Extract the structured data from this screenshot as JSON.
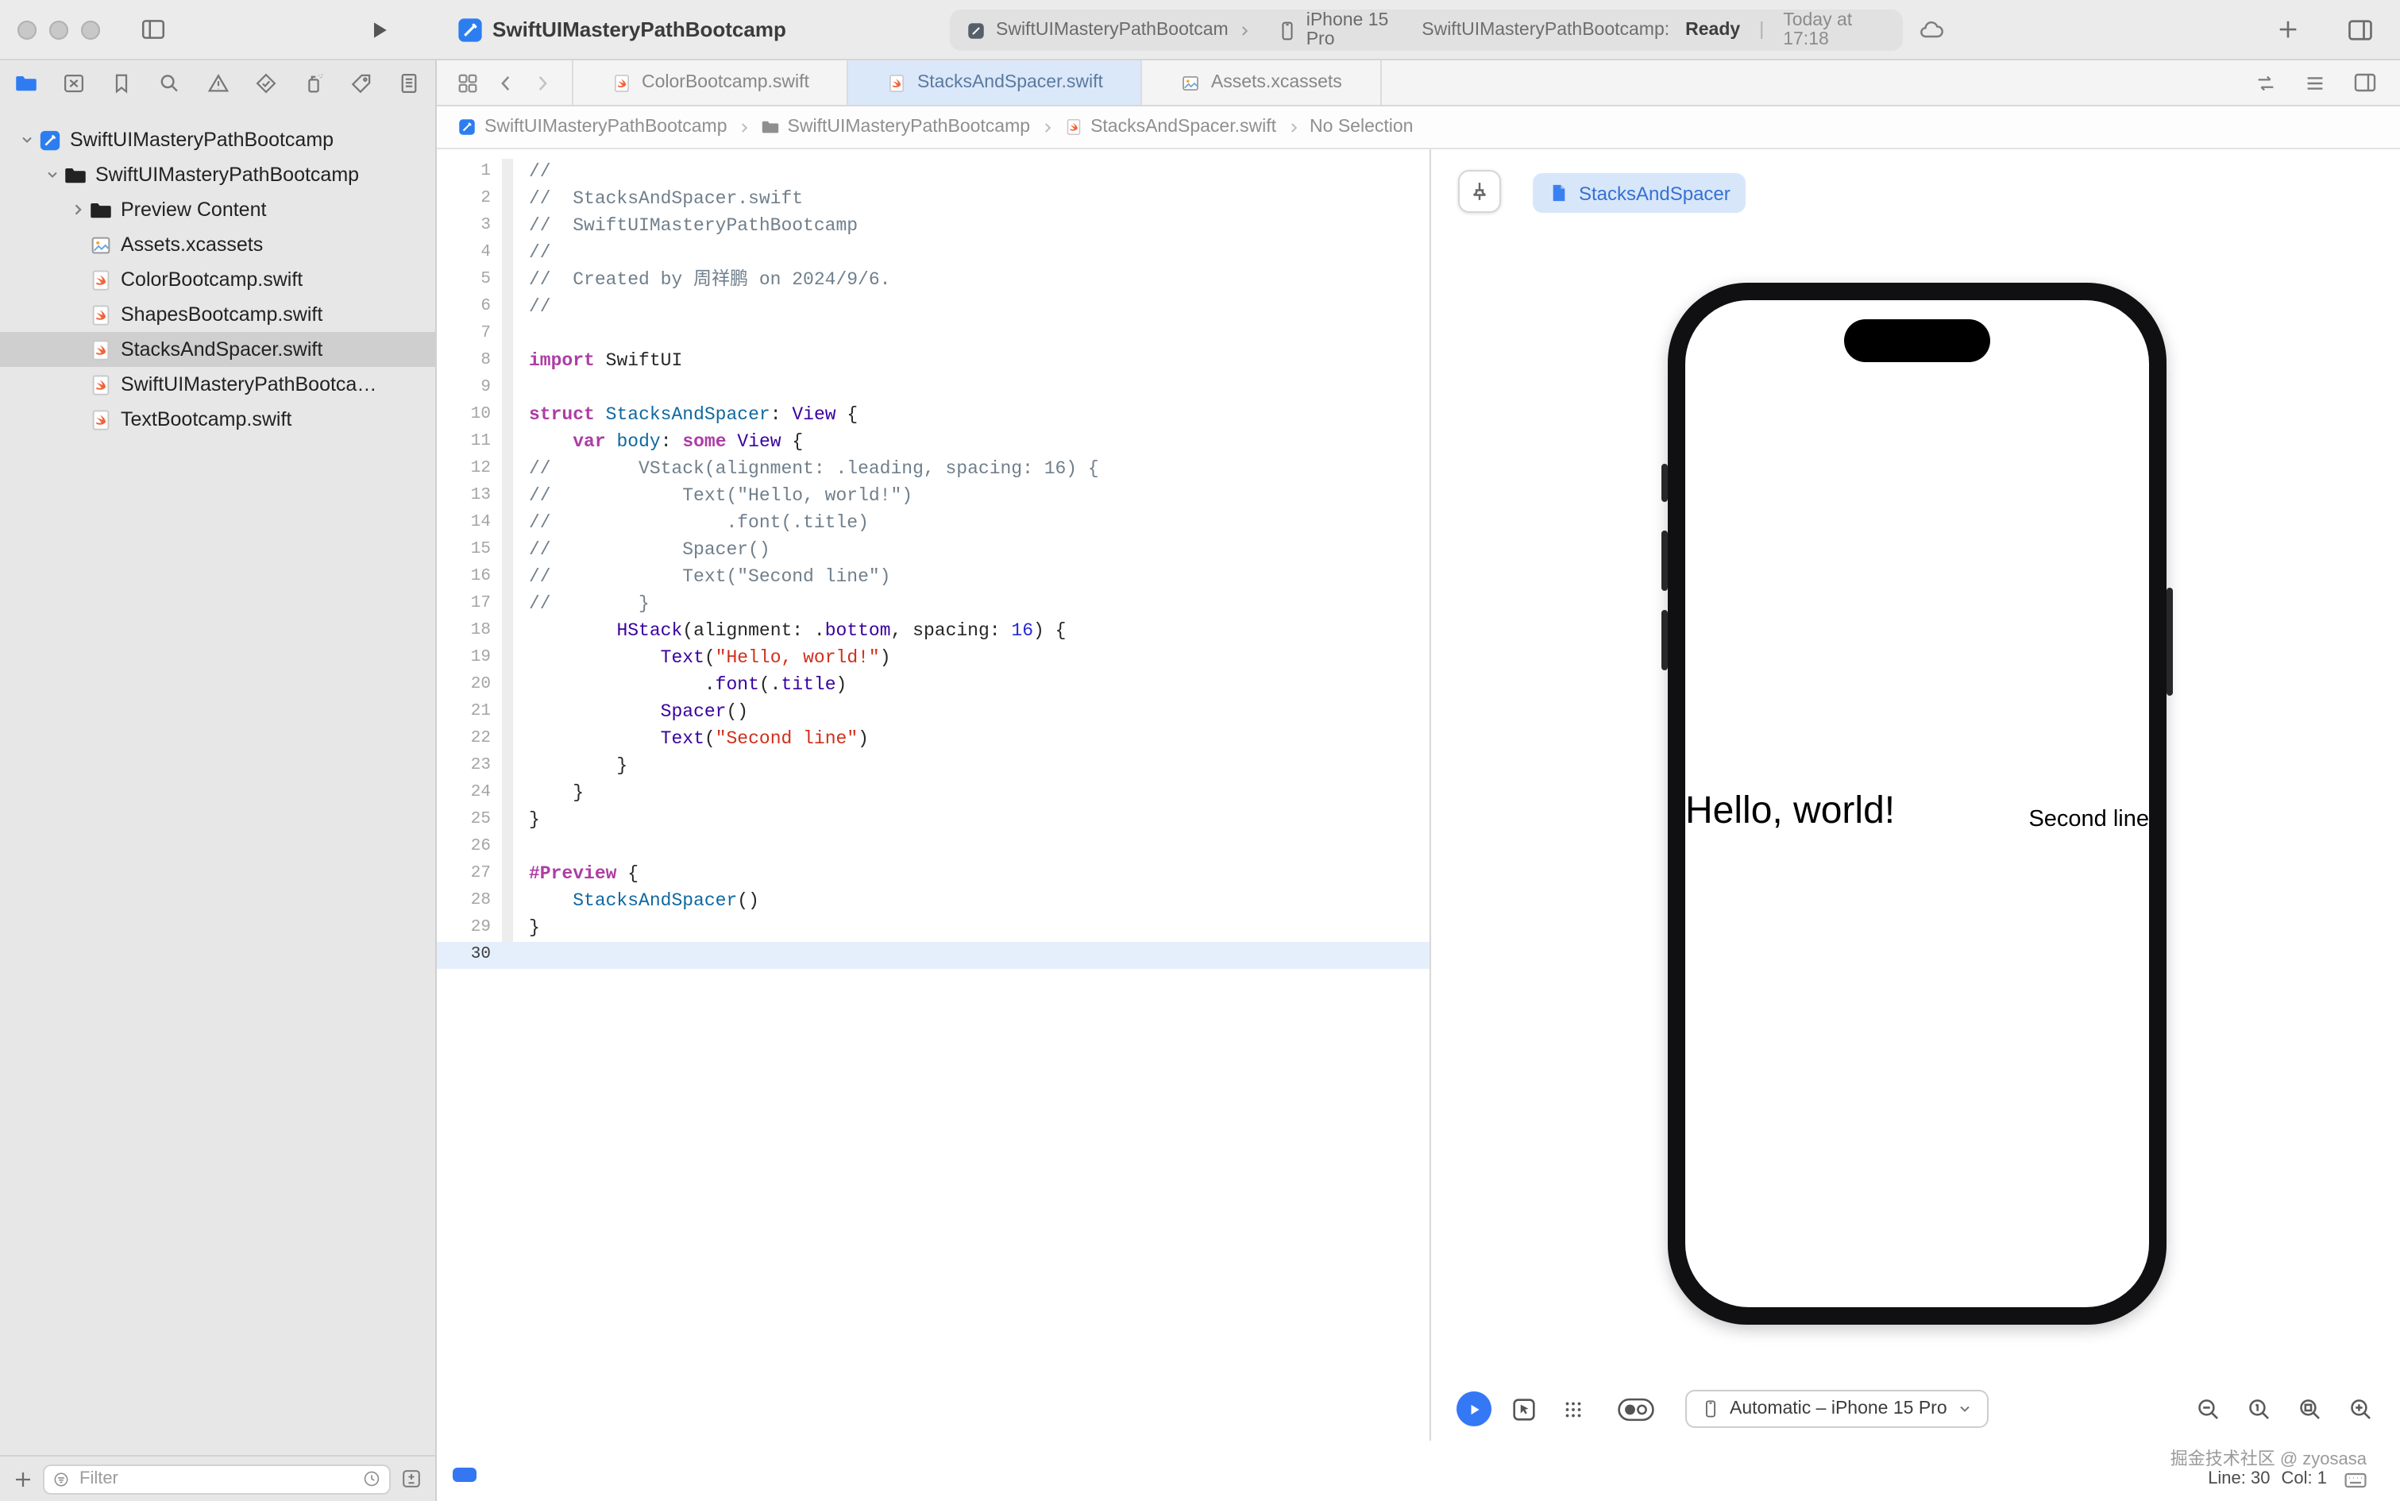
{
  "colors": {
    "accent": "#3478f6",
    "tab_active_bg": "#dbe8fa",
    "chip_bg": "#d8e6fa",
    "selection_bg": "#cfcfcf",
    "current_line_bg": "#e5effc",
    "syntax": {
      "comment": "#707f8c",
      "keyword": "#ad3da4",
      "plain": "#262626",
      "type": "#3900a0",
      "declaration": "#0f68a0",
      "string": "#d12f1b",
      "number": "#272ad8"
    }
  },
  "titlebar": {
    "title": "SwiftUIMasteryPathBootcamp",
    "scheme": "SwiftUIMasteryPathBootcam",
    "destination": "iPhone 15 Pro",
    "status_project": "SwiftUIMasteryPathBootcamp:",
    "status_state": "Ready",
    "status_separator": "|",
    "status_time": "Today at 17:18"
  },
  "tabbar": {
    "tabs": [
      {
        "label": "ColorBootcamp.swift",
        "icon": "swiftdoc",
        "active": false
      },
      {
        "label": "StacksAndSpacer.swift",
        "icon": "swiftdoc",
        "active": true
      },
      {
        "label": "Assets.xcassets",
        "icon": "assets",
        "active": false
      }
    ]
  },
  "jumpbar": {
    "items": [
      {
        "label": "SwiftUIMasteryPathBootcamp",
        "icon": "appicon"
      },
      {
        "label": "SwiftUIMasteryPathBootcamp",
        "icon": "folder"
      },
      {
        "label": "StacksAndSpacer.swift",
        "icon": "swiftdoc"
      },
      {
        "label": "No Selection",
        "icon": null
      }
    ]
  },
  "sidebar": {
    "tree": [
      {
        "label": "SwiftUIMasteryPathBootcamp",
        "icon": "appicon",
        "depth": 0,
        "chevron": "down",
        "selected": false
      },
      {
        "label": "SwiftUIMasteryPathBootcamp",
        "icon": "folder",
        "depth": 1,
        "chevron": "down",
        "selected": false
      },
      {
        "label": "Preview Content",
        "icon": "folder",
        "depth": 2,
        "chevron": "right",
        "selected": false
      },
      {
        "label": "Assets.xcassets",
        "icon": "assets",
        "depth": 2,
        "chevron": null,
        "selected": false
      },
      {
        "label": "ColorBootcamp.swift",
        "icon": "swiftdoc",
        "depth": 2,
        "chevron": null,
        "selected": false
      },
      {
        "label": "ShapesBootcamp.swift",
        "icon": "swiftdoc",
        "depth": 2,
        "chevron": null,
        "selected": false
      },
      {
        "label": "StacksAndSpacer.swift",
        "icon": "swiftdoc",
        "depth": 2,
        "chevron": null,
        "selected": true
      },
      {
        "label": "SwiftUIMasteryPathBootca…",
        "icon": "swiftdoc",
        "depth": 2,
        "chevron": null,
        "selected": false
      },
      {
        "label": "TextBootcamp.swift",
        "icon": "swiftdoc",
        "depth": 2,
        "chevron": null,
        "selected": false
      }
    ],
    "filter_placeholder": "Filter"
  },
  "editor": {
    "current_line": 30,
    "line_count": 30,
    "lines": [
      [
        [
          "//",
          "c"
        ]
      ],
      [
        [
          "//  StacksAndSpacer.swift",
          "c"
        ]
      ],
      [
        [
          "//  SwiftUIMasteryPathBootcamp",
          "c"
        ]
      ],
      [
        [
          "//",
          "c"
        ]
      ],
      [
        [
          "//  Created by 周祥鹏 on 2024/9/6.",
          "c"
        ]
      ],
      [
        [
          "//",
          "c"
        ]
      ],
      [],
      [
        [
          "import",
          "k"
        ],
        [
          " SwiftUI",
          "p"
        ]
      ],
      [],
      [
        [
          "struct",
          "k"
        ],
        [
          " ",
          "p"
        ],
        [
          "StacksAndSpacer",
          "d"
        ],
        [
          ": ",
          "p"
        ],
        [
          "View",
          "t"
        ],
        [
          " {",
          "p"
        ]
      ],
      [
        [
          "    ",
          "p"
        ],
        [
          "var",
          "k"
        ],
        [
          " ",
          "p"
        ],
        [
          "body",
          "d"
        ],
        [
          ": ",
          "p"
        ],
        [
          "some",
          "k"
        ],
        [
          " ",
          "p"
        ],
        [
          "View",
          "t"
        ],
        [
          " {",
          "p"
        ]
      ],
      [
        [
          "//        VStack(alignment: .leading, spacing: 16) {",
          "c"
        ]
      ],
      [
        [
          "//            Text(\"Hello, world!\")",
          "c"
        ]
      ],
      [
        [
          "//                .font(.title)",
          "c"
        ]
      ],
      [
        [
          "//            Spacer()",
          "c"
        ]
      ],
      [
        [
          "//            Text(\"Second line\")",
          "c"
        ]
      ],
      [
        [
          "//        }",
          "c"
        ]
      ],
      [
        [
          "        ",
          "p"
        ],
        [
          "HStack",
          "t"
        ],
        [
          "(alignment: .",
          "p"
        ],
        [
          "bottom",
          "t"
        ],
        [
          ", spacing: ",
          "p"
        ],
        [
          "16",
          "n"
        ],
        [
          ") {",
          "p"
        ]
      ],
      [
        [
          "            ",
          "p"
        ],
        [
          "Text",
          "t"
        ],
        [
          "(",
          "p"
        ],
        [
          "\"Hello, world!\"",
          "s"
        ],
        [
          ")",
          "p"
        ]
      ],
      [
        [
          "                .",
          "p"
        ],
        [
          "font",
          "t"
        ],
        [
          "(.",
          "p"
        ],
        [
          "title",
          "t"
        ],
        [
          ")",
          "p"
        ]
      ],
      [
        [
          "            ",
          "p"
        ],
        [
          "Spacer",
          "t"
        ],
        [
          "()",
          "p"
        ]
      ],
      [
        [
          "            ",
          "p"
        ],
        [
          "Text",
          "t"
        ],
        [
          "(",
          "p"
        ],
        [
          "\"Second line\"",
          "s"
        ],
        [
          ")",
          "p"
        ]
      ],
      [
        [
          "        }",
          "p"
        ]
      ],
      [
        [
          "    }",
          "p"
        ]
      ],
      [
        [
          "}",
          "p"
        ]
      ],
      [],
      [
        [
          "#Preview",
          "k"
        ],
        [
          " {",
          "p"
        ]
      ],
      [
        [
          "    ",
          "p"
        ],
        [
          "StacksAndSpacer",
          "d"
        ],
        [
          "()",
          "p"
        ]
      ],
      [
        [
          "}",
          "p"
        ]
      ],
      []
    ]
  },
  "canvas": {
    "chip_label": "StacksAndSpacer",
    "device_menu": "Automatic – iPhone 15 Pro",
    "preview": {
      "primary_text": "Hello, world!",
      "secondary_text": "Second line"
    }
  },
  "statusbar": {
    "watermark": "掘金技术社区 @ zyosasa",
    "line_label": "Line: 30",
    "col_label": "Col: 1"
  }
}
